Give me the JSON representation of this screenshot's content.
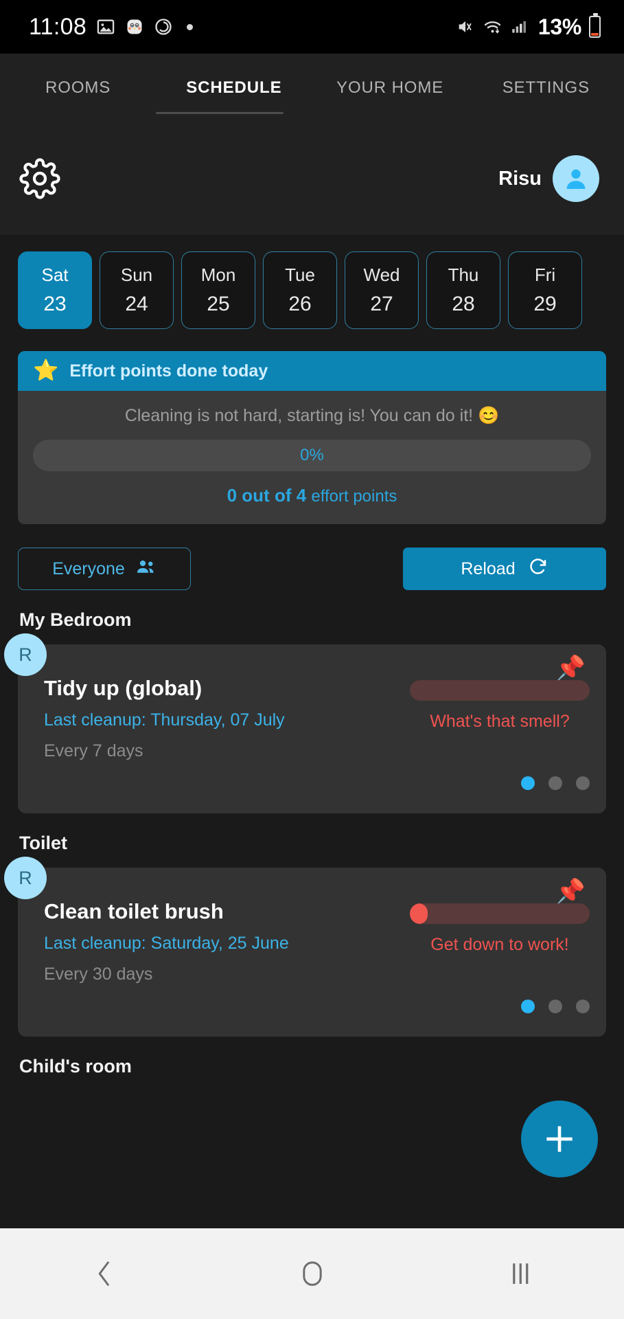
{
  "status_bar": {
    "time": "11:08",
    "icons": [
      "image-icon",
      "penguin-emoji-icon",
      "alarm-icon",
      "dot-icon"
    ],
    "right_icons": [
      "mute-icon",
      "wifi-icon",
      "signal-icon"
    ],
    "battery_percent": "13%"
  },
  "tabs": [
    {
      "label": "ROOMS",
      "active": false
    },
    {
      "label": "SCHEDULE",
      "active": true
    },
    {
      "label": "YOUR HOME",
      "active": false
    },
    {
      "label": "SETTINGS",
      "active": false
    }
  ],
  "header": {
    "settings_icon": "gear-icon",
    "user_name": "Risu",
    "avatar_icon": "person-icon"
  },
  "day_strip": [
    {
      "name": "Sat",
      "number": "23",
      "selected": true
    },
    {
      "name": "Sun",
      "number": "24",
      "selected": false
    },
    {
      "name": "Mon",
      "number": "25",
      "selected": false
    },
    {
      "name": "Tue",
      "number": "26",
      "selected": false
    },
    {
      "name": "Wed",
      "number": "27",
      "selected": false
    },
    {
      "name": "Thu",
      "number": "28",
      "selected": false
    },
    {
      "name": "Fri",
      "number": "29",
      "selected": false
    }
  ],
  "effort_card": {
    "star_icon": "star-icon",
    "title": "Effort points done today",
    "message": "Cleaning is not hard, starting is! You can do it! 😊",
    "progress_percent_label": "0%",
    "progress_value": 0,
    "count_bold": "0 out of 4",
    "count_rest": "effort points"
  },
  "filter_bar": {
    "everyone_label": "Everyone",
    "everyone_icon": "people-icon",
    "reload_label": "Reload",
    "reload_icon": "refresh-icon"
  },
  "rooms": [
    {
      "room_name": "My Bedroom",
      "tasks": [
        {
          "badge": "R",
          "pin_icon": "pin-icon",
          "title": "Tidy up (global)",
          "last_cleanup": "Last cleanup: Thursday, 07 July",
          "frequency": "Every 7 days",
          "status_message": "What's that smell?",
          "bar_fill_percent": 0,
          "page_dots": 3,
          "active_dot": 0
        }
      ]
    },
    {
      "room_name": "Toilet",
      "tasks": [
        {
          "badge": "R",
          "pin_icon": "pin-icon",
          "title": "Clean toilet brush",
          "last_cleanup": "Last cleanup: Saturday, 25 June",
          "frequency": "Every 30 days",
          "status_message": "Get down to work!",
          "bar_fill_percent": 10,
          "page_dots": 3,
          "active_dot": 0
        }
      ]
    },
    {
      "room_name": "Child's room",
      "tasks": []
    }
  ],
  "fab": {
    "icon": "plus-icon"
  },
  "nav_bar": {
    "back_icon": "back-icon",
    "home_icon": "home-icon",
    "recents_icon": "recents-icon"
  },
  "colors": {
    "accent": "#0c84b4",
    "accent_light": "#29b6f6",
    "danger": "#ef5350",
    "avatar": "#a6e2fb",
    "card": "#333333",
    "background": "#1a1a1a"
  }
}
